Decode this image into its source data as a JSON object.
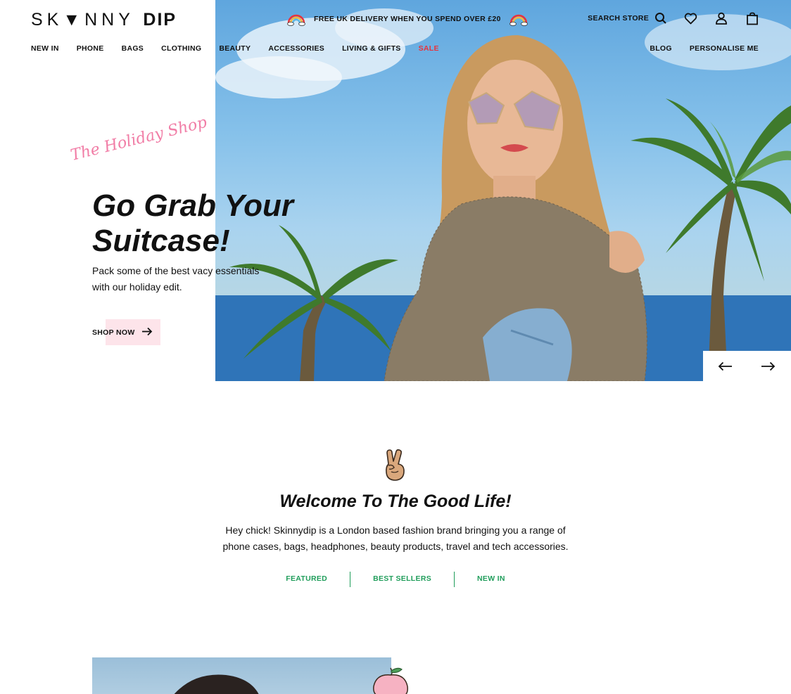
{
  "brand": {
    "logo_light": "SK▼NNY",
    "logo_bold": "DIP"
  },
  "promo": {
    "text": "FREE UK DELIVERY WHEN YOU SPEND OVER £20"
  },
  "header": {
    "search_label": "SEARCH STORE"
  },
  "nav": {
    "items": [
      "NEW IN",
      "PHONE",
      "BAGS",
      "CLOTHING",
      "BEAUTY",
      "ACCESSORIES",
      "LIVING & GIFTS",
      "SALE"
    ],
    "right": [
      "BLOG",
      "PERSONALISE ME"
    ]
  },
  "hero": {
    "script": "The Holiday Shop",
    "title": "Go Grab Your Suitcase!",
    "description": "Pack some of the best vacy essentials with our holiday edit.",
    "cta": "SHOP NOW"
  },
  "welcome": {
    "title": "Welcome To The Good Life!",
    "text": "Hey chick! Skinnydip is a London based fashion brand bringing you a range of phone cases, bags, headphones, beauty products, travel and tech accessories.",
    "tabs": [
      "FEATURED",
      "BEST SELLERS",
      "NEW IN"
    ]
  },
  "colors": {
    "sale": "#e8323c",
    "script_pink": "#f17da6",
    "tab_green": "#1f9d5a",
    "cta_bg": "#fde4ea"
  },
  "icons": [
    "rainbow-icon",
    "search-icon",
    "heart-icon",
    "user-icon",
    "bag-icon",
    "arrow-right-icon",
    "arrow-left-icon",
    "peace-hand-icon",
    "peach-icon"
  ]
}
